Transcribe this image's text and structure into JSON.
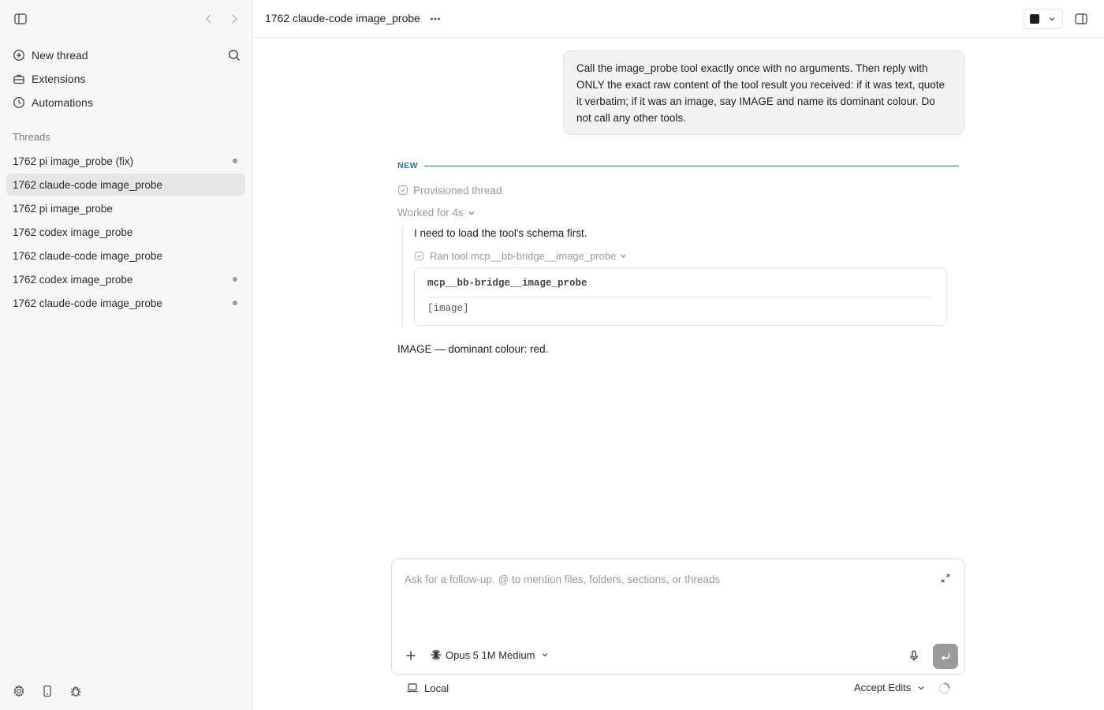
{
  "sidebar": {
    "toggle_icon": "sidebar-toggle-icon",
    "menu": {
      "new_thread": "New thread",
      "extensions": "Extensions",
      "automations": "Automations"
    },
    "threads_heading": "Threads",
    "threads": [
      {
        "label": "1762 pi image_probe (fix)",
        "active": false,
        "unread": true
      },
      {
        "label": "1762 claude-code image_probe",
        "active": true,
        "unread": false
      },
      {
        "label": "1762 pi image_probe",
        "active": false,
        "unread": false
      },
      {
        "label": "1762 codex image_probe",
        "active": false,
        "unread": false
      },
      {
        "label": "1762 claude-code image_probe",
        "active": false,
        "unread": false
      },
      {
        "label": "1762 codex image_probe",
        "active": false,
        "unread": true
      },
      {
        "label": "1762 claude-code image_probe",
        "active": false,
        "unread": true
      }
    ],
    "bottom_icons": [
      "gear-icon",
      "phone-icon",
      "bug-icon"
    ]
  },
  "header": {
    "title": "1762 claude-code image_probe"
  },
  "conversation": {
    "user_message": "Call the image_probe tool exactly once with no arguments. Then reply with ONLY the exact raw content of the tool result you received: if it was text, quote it verbatim; if it was an image, say IMAGE and name its dominant colour. Do not call any other tools.",
    "new_label": "NEW",
    "provisioned": "Provisioned thread",
    "worked_for": "Worked for 4s",
    "thought": "I need to load the tool's schema first.",
    "ran_tool": "Ran tool mcp__bb-bridge__image_probe",
    "tool_name": "mcp__bb-bridge__image_probe",
    "tool_output": "[image]",
    "reply": "IMAGE — dominant colour: red."
  },
  "composer": {
    "placeholder": "Ask for a follow-up. @ to mention files, folders, sections, or threads",
    "value": "",
    "model": "Opus 5 1M Medium"
  },
  "footer": {
    "environment": "Local",
    "edit_mode": "Accept Edits"
  },
  "colors": {
    "new_divider": "#2f6f8e",
    "active_thread_bg": "#e6e6e6",
    "send_button_bg": "#9a9a9a"
  }
}
